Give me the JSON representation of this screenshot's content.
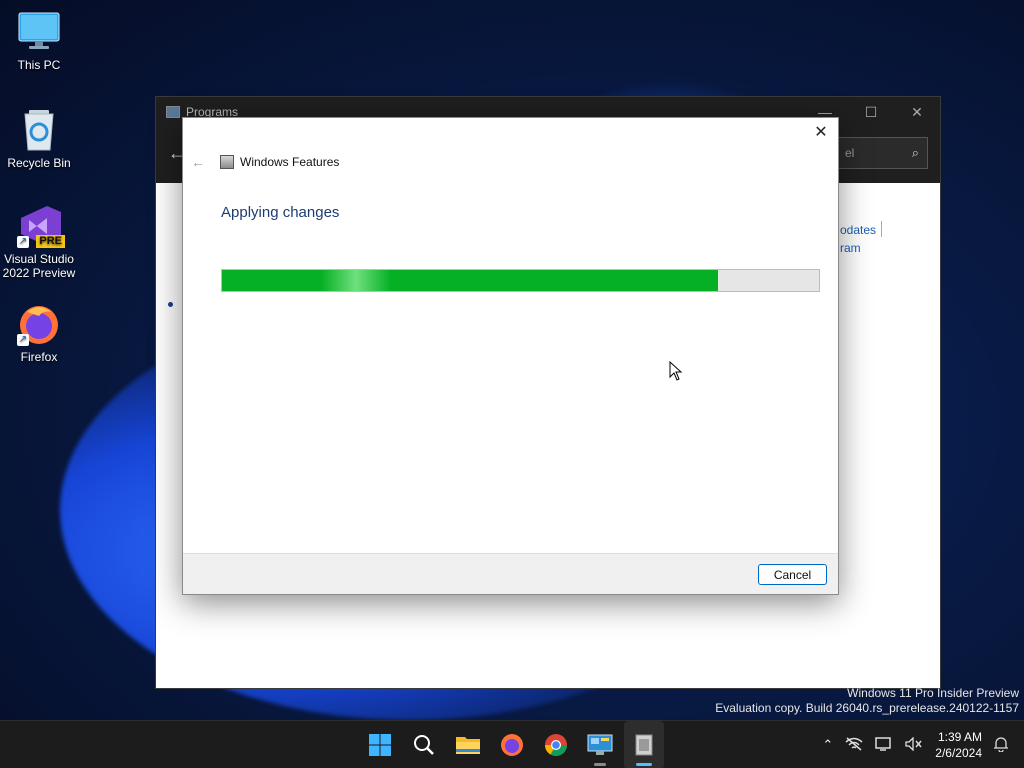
{
  "desktop": {
    "icons": [
      {
        "label": "This PC"
      },
      {
        "label": "Recycle Bin"
      },
      {
        "label": "Visual Studio 2022 Preview",
        "badge": "PRE"
      },
      {
        "label": "Firefox"
      }
    ]
  },
  "background_window": {
    "title": "Programs",
    "search_placeholder": "el",
    "links": [
      "odates",
      "ram"
    ]
  },
  "dialog": {
    "title": "Windows Features",
    "heading": "Applying changes",
    "progress_percent": 83,
    "cancel_label": "Cancel"
  },
  "watermark": {
    "line1": "Windows 11 Pro Insider Preview",
    "line2": "Evaluation copy. Build 26040.rs_prerelease.240122-1157"
  },
  "taskbar": {
    "apps": [
      {
        "icon": "start-icon"
      },
      {
        "icon": "search-icon"
      },
      {
        "icon": "file-explorer-icon"
      },
      {
        "icon": "firefox-icon"
      },
      {
        "icon": "chrome-icon"
      },
      {
        "icon": "control-panel-icon"
      },
      {
        "icon": "windows-features-icon",
        "active": true
      }
    ],
    "time": "1:39 AM",
    "date": "2/6/2024"
  },
  "colors": {
    "progress_green": "#06b025",
    "accent": "#0067c0",
    "heading_blue": "#1e3c73"
  }
}
